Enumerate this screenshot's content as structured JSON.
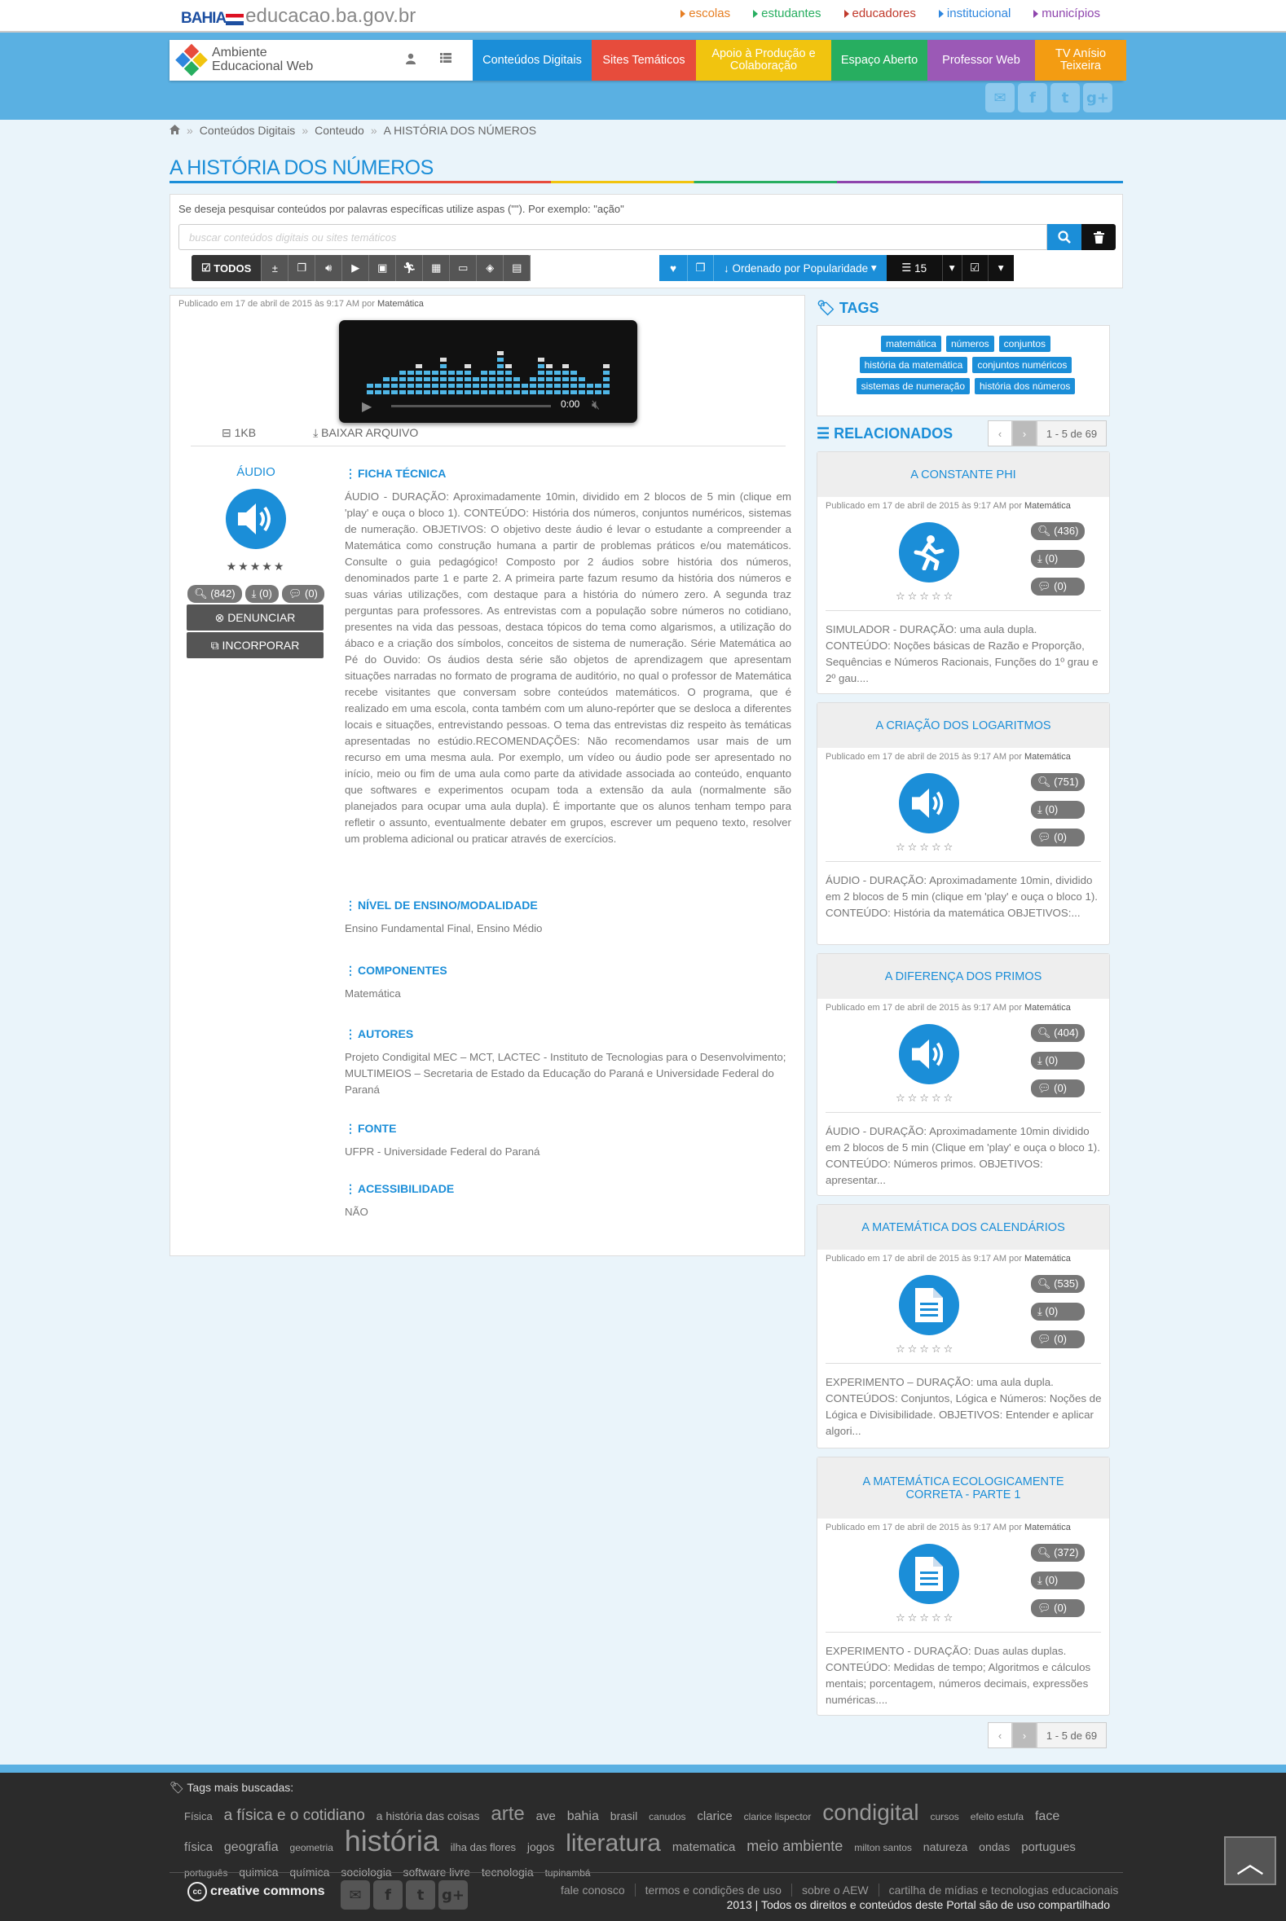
{
  "gov": {
    "logo_text": "BAHIA",
    "domain": "educacao.ba.gov.br",
    "links": [
      {
        "label": "escolas",
        "color": "#e67e22"
      },
      {
        "label": "estudantes",
        "color": "#27ae60"
      },
      {
        "label": "educadores",
        "color": "#c0392b"
      },
      {
        "label": "institucional",
        "color": "#2e86de"
      },
      {
        "label": "municípios",
        "color": "#8e44ad"
      }
    ]
  },
  "brand": {
    "line1": "Ambiente",
    "line2": "Educacional Web"
  },
  "nav": [
    {
      "label": "Conteúdos Digitais",
      "color": "#1b8ed8"
    },
    {
      "label": "Sites Temáticos",
      "color": "#e74c3c"
    },
    {
      "label": "Apoio à Produção e Colaboração",
      "color": "#f1c40f"
    },
    {
      "label": "Espaço Aberto",
      "color": "#27ae60"
    },
    {
      "label": "Professor Web",
      "color": "#9b59b6"
    },
    {
      "label": "TV Anísio Teixeira",
      "color": "#f39c12"
    }
  ],
  "breadcrumb": [
    "Conteúdos Digitais",
    "Conteudo",
    "A HISTÓRIA DOS NÚMEROS"
  ],
  "title": "A HISTÓRIA DOS NÚMEROS",
  "search": {
    "hint": "Se deseja pesquisar conteúdos por palavras específicas utilize aspas (\"\"). Por exemplo: \"ação\"",
    "placeholder": "buscar conteúdos digitais ou sites temáticos",
    "value": ""
  },
  "filters": {
    "all_label": "TODOS"
  },
  "sort": {
    "label": "Ordenado por Popularidade",
    "per_page": "15"
  },
  "content": {
    "pub_prefix": "Publicado em 17 de abril de 2015 às 9:17 AM por",
    "author": "Matemática",
    "player_time": "0:00",
    "file_size": "1KB",
    "download_label": "BAIXAR ARQUIVO",
    "type_label": "ÁUDIO",
    "stars": "★★★★★",
    "views": "(842)",
    "downloads": "(0)",
    "comments": "(0)",
    "report_label": "DENUNCIAR",
    "embed_label": "INCORPORAR",
    "ficha_h": "FICHA TÉCNICA",
    "ficha": "ÁUDIO - DURAÇÃO: Aproximadamente 10min, dividido em 2 blocos de 5 min (clique em 'play' e ouça o bloco 1). CONTEÚDO: História dos números, conjuntos numéricos, sistemas de numeração. OBJETIVOS: O objetivo deste áudio é levar o estudante a compreender a Matemática como construção humana a partir de problemas práticos e/ou matemáticos. Consulte o guia pedagógico! Composto por 2 áudios sobre história dos números, denominados parte 1 e parte 2. A primeira parte fazum resumo da história dos números e suas várias utilizações, com destaque para a história do número zero. A segunda traz perguntas para professores. As entrevistas com a população sobre números no cotidiano, presentes na vida das pessoas, destaca tópicos do tema como algarismos, a utilização do ábaco e a criação dos símbolos, conceitos de sistema de numeração. Série Matemática ao Pé do Ouvido: Os áudios desta série são objetos de aprendizagem que apresentam situações narradas no formato de programa de auditório, no qual o professor de Matemática recebe visitantes que conversam sobre conteúdos matemáticos. O programa, que é realizado em uma escola, conta também com um aluno-repórter que se desloca a diferentes locais e situações, entrevistando pessoas. O tema das entrevistas diz respeito às temáticas apresentadas no estúdio.RECOMENDAÇÕES: Não recomendamos usar mais de um recurso em uma mesma aula. Por exemplo, um vídeo ou áudio pode ser apresentado no início, meio ou fim de uma aula como parte da atividade associada ao conteúdo, enquanto que softwares e experimentos ocupam toda a extensão da aula (normalmente são planejados para ocupar uma aula dupla). É importante que os alunos tenham tempo para refletir o assunto, eventualmente debater em grupos, escrever um pequeno texto, resolver um problema adicional ou praticar através de exercícios.",
    "nivel_h": "NÍVEL DE ENSINO/MODALIDADE",
    "nivel": "Ensino Fundamental Final,  Ensino Médio",
    "comp_h": "COMPONENTES",
    "comp": "Matemática",
    "autores_h": "AUTORES",
    "autores": "Projeto Condigital MEC – MCT, LACTEC - Instituto de Tecnologias para o Desenvolvimento; MULTIMEIOS – Secretaria de Estado da Educação do Paraná e Universidade Federal do Paraná",
    "fonte_h": "FONTE",
    "fonte": "UFPR - Universidade Federal do Paraná",
    "acess_h": "ACESSIBILIDADE",
    "acess": "NÃO"
  },
  "tags": {
    "heading": "TAGS",
    "items": [
      "matemática",
      "números",
      "conjuntos",
      "história da matemática",
      "conjuntos numéricos",
      "sistemas de numeração",
      "história dos números"
    ]
  },
  "related": {
    "heading": "RELACIONADOS",
    "pager": "1 - 5 de 69",
    "items": [
      {
        "title": "A CONSTANTE PHI",
        "icon": "runner-icon",
        "views": "(436)",
        "downloads": "(0)",
        "comments": "(0)",
        "desc": "SIMULADOR - DURAÇÃO: uma aula dupla. CONTEÚDO: Noções básicas de Razão e Proporção, Sequências e Números Racionais, Funções do 1º grau e 2º gau...."
      },
      {
        "title": "A CRIAÇÃO DOS LOGARITMOS",
        "icon": "speaker-icon",
        "views": "(751)",
        "downloads": "(0)",
        "comments": "(0)",
        "desc": "ÁUDIO - DURAÇÃO: Aproximadamente 10min, dividido em 2 blocos de 5 min (clique em 'play' e ouça o bloco 1). CONTEÚDO: História da matemática OBJETIVOS:..."
      },
      {
        "title": "A DIFERENÇA DOS PRIMOS",
        "icon": "speaker-icon",
        "views": "(404)",
        "downloads": "(0)",
        "comments": "(0)",
        "desc": "ÁUDIO - DURAÇÃO: Aproximadamente 10min dividido em 2 blocos de 5 min (Clique em 'play' e ouça o bloco 1). CONTEÚDO: Números primos. OBJETIVOS: apresentar..."
      },
      {
        "title": "A MATEMÁTICA DOS CALENDÁRIOS",
        "icon": "document-icon",
        "views": "(535)",
        "downloads": "(0)",
        "comments": "(0)",
        "desc": "EXPERIMENTO – DURAÇÃO: uma aula dupla. CONTEÚDOS: Conjuntos, Lógica e Números: Noções de Lógica e Divisibilidade. OBJETIVOS: Entender e aplicar algori..."
      },
      {
        "title": "A MATEMÁTICA ECOLOGICAMENTE CORRETA - PARTE 1",
        "icon": "document-icon",
        "views": "(372)",
        "downloads": "(0)",
        "comments": "(0)",
        "desc": "EXPERIMENTO - DURAÇÃO: Duas aulas duplas. CONTEÚDO: Medidas de tempo; Algoritmos e cálculos mentais; porcentagem, números decimais, expressões numéricas...."
      }
    ]
  },
  "footer": {
    "tags_heading": "Tags mais buscadas:",
    "cloud": [
      {
        "t": "Física",
        "s": 13
      },
      {
        "t": "a física e o cotidiano",
        "s": 19
      },
      {
        "t": "a história das coisas",
        "s": 14
      },
      {
        "t": "arte",
        "s": 24
      },
      {
        "t": "ave",
        "s": 15
      },
      {
        "t": "bahia",
        "s": 16
      },
      {
        "t": "brasil",
        "s": 14
      },
      {
        "t": "canudos",
        "s": 12
      },
      {
        "t": "clarice",
        "s": 15
      },
      {
        "t": "clarice lispector",
        "s": 12
      },
      {
        "t": "condigital",
        "s": 28
      },
      {
        "t": "cursos",
        "s": 12
      },
      {
        "t": "efeito estufa",
        "s": 12
      },
      {
        "t": "face",
        "s": 16
      },
      {
        "t": "física",
        "s": 15
      },
      {
        "t": "geografia",
        "s": 16
      },
      {
        "t": "geometria",
        "s": 12
      },
      {
        "t": "história",
        "s": 36
      },
      {
        "t": "ilha das flores",
        "s": 13
      },
      {
        "t": "jogos",
        "s": 14
      },
      {
        "t": "literatura",
        "s": 30
      },
      {
        "t": "matematica",
        "s": 15
      },
      {
        "t": "meio ambiente",
        "s": 18
      },
      {
        "t": "milton santos",
        "s": 12
      },
      {
        "t": "natureza",
        "s": 14
      },
      {
        "t": "ondas",
        "s": 14
      },
      {
        "t": "portugues",
        "s": 15
      },
      {
        "t": "português",
        "s": 12
      },
      {
        "t": "quimica",
        "s": 14
      },
      {
        "t": "química",
        "s": 14
      },
      {
        "t": "sociologia",
        "s": 14
      },
      {
        "t": "software livre",
        "s": 14
      },
      {
        "t": "tecnologia",
        "s": 14
      },
      {
        "t": "tupinambá",
        "s": 12
      }
    ],
    "cc_label": "creative commons",
    "links": [
      "fale conosco",
      "termos e condições de uso",
      "sobre o AEW",
      "cartilha de mídias e tecnologias educacionais"
    ],
    "copyright": "2013 | Todos os direitos e conteúdos deste Portal são de uso compartilhado"
  }
}
